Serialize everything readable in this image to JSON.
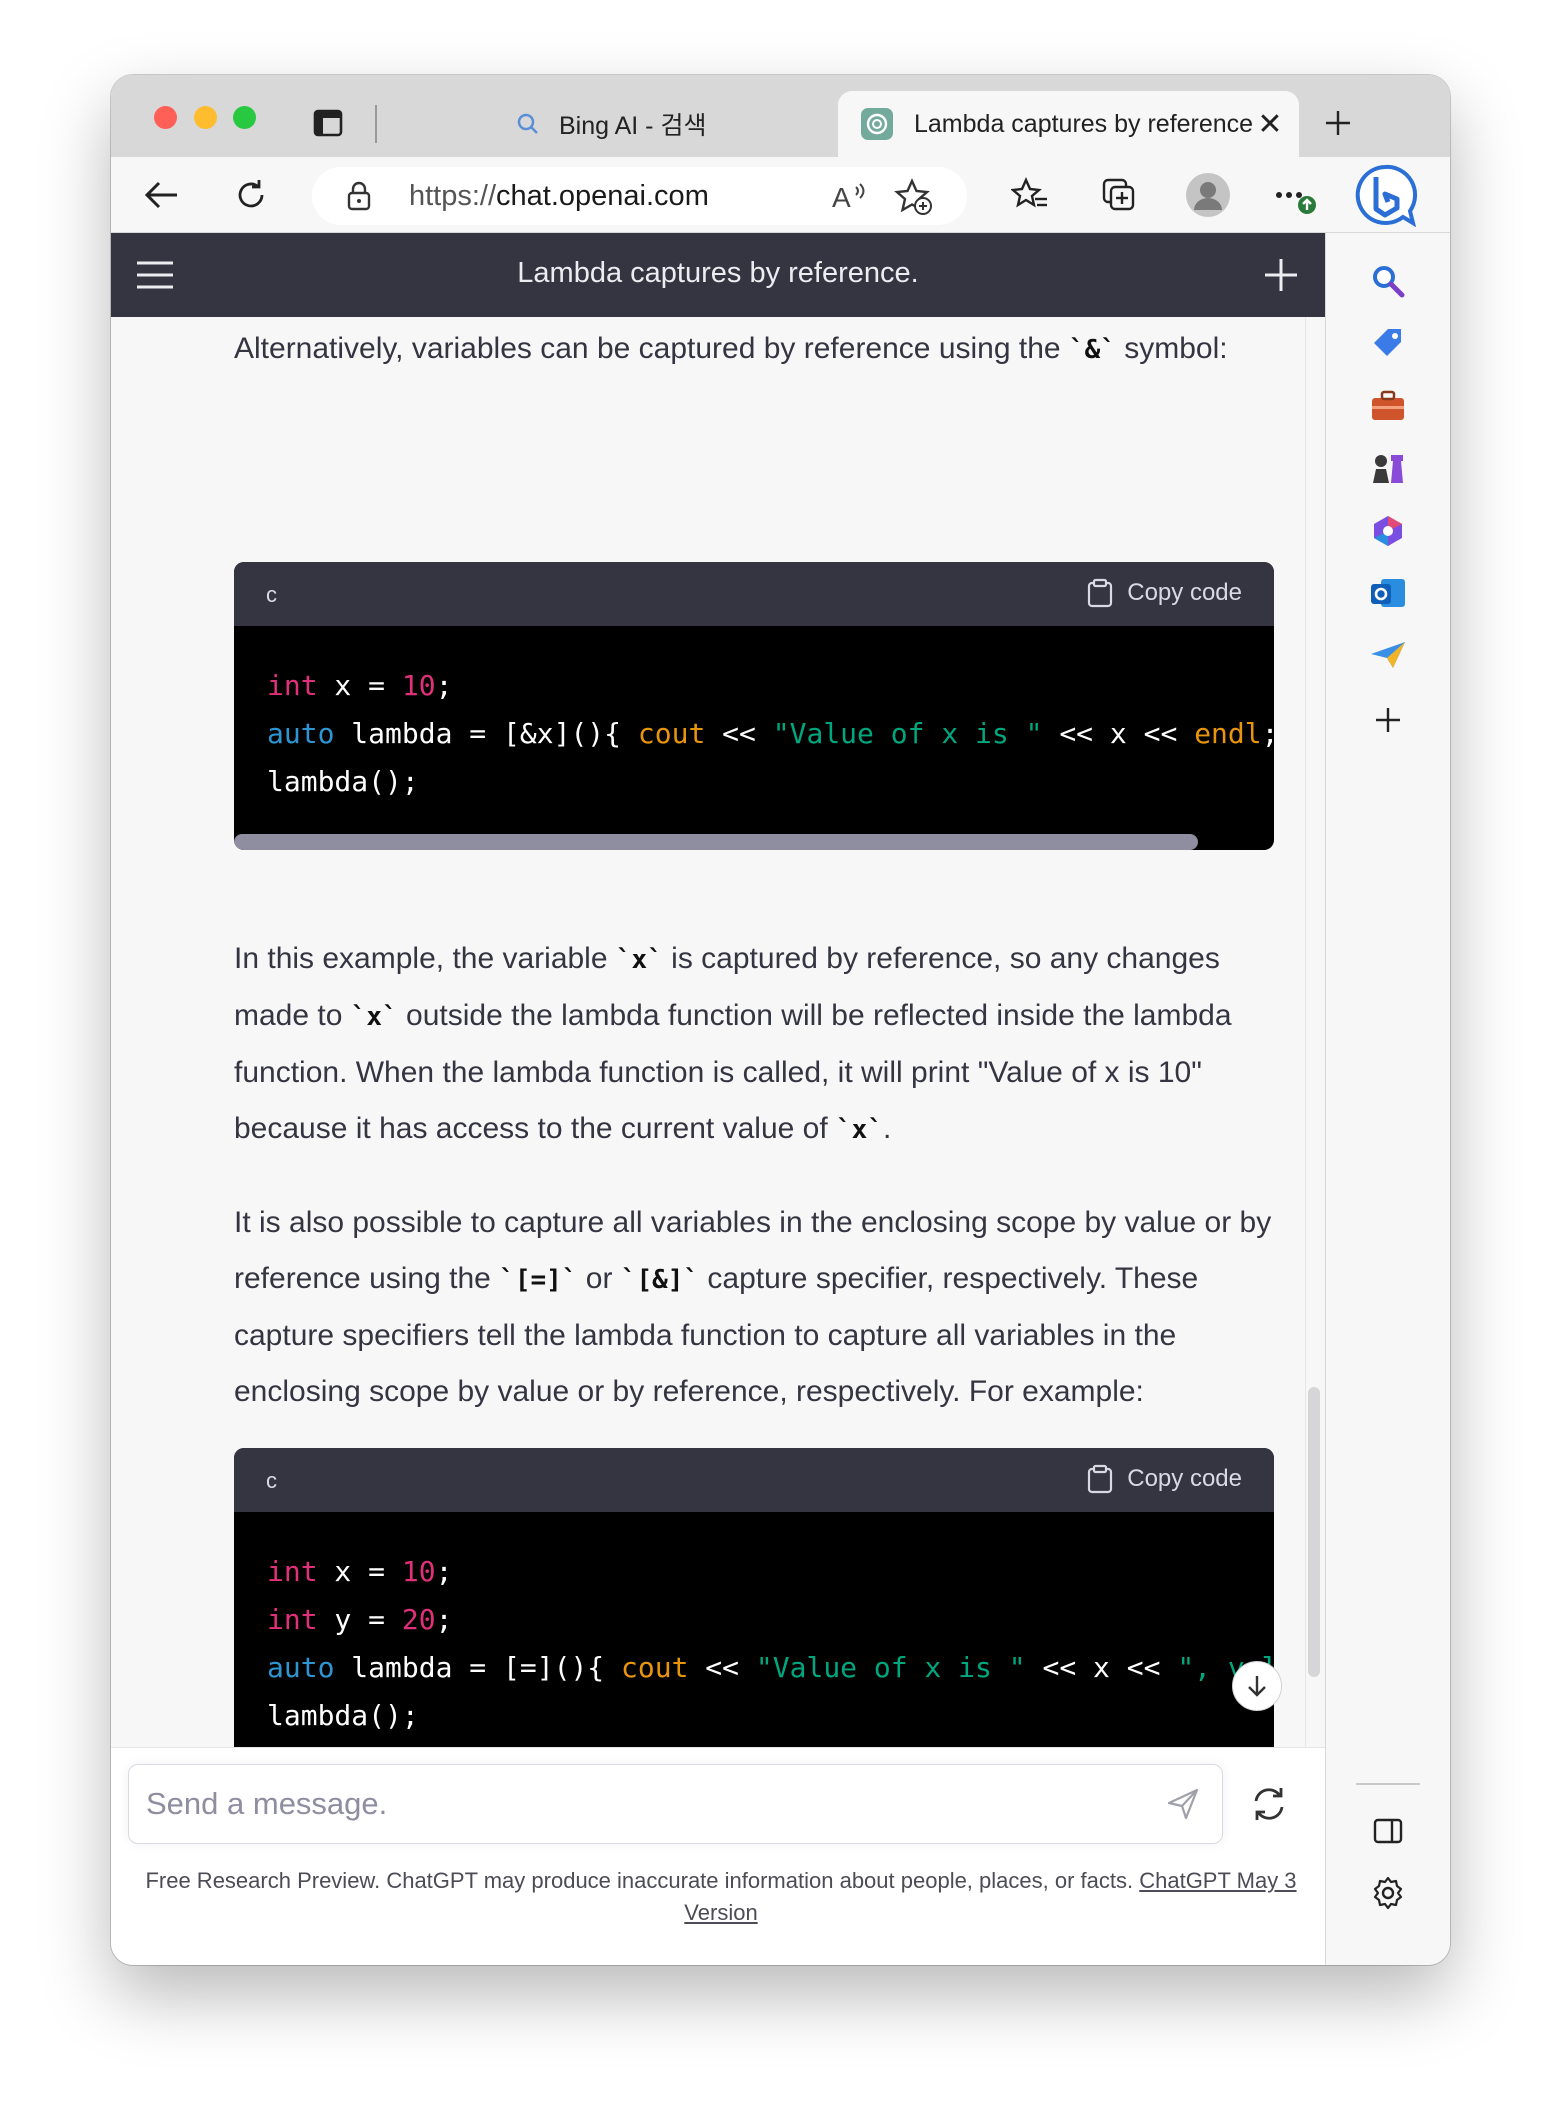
{
  "browser": {
    "tabs": [
      {
        "title": "Bing AI - 검색",
        "active": false
      },
      {
        "title": "Lambda captures by reference",
        "active": true
      }
    ],
    "address": {
      "scheme": "https://",
      "host": "chat.openai.com"
    }
  },
  "chat": {
    "header_title": "Lambda captures by reference.",
    "p1": {
      "pre": "Alternatively, variables can be captured by reference using the ",
      "code": "`&`",
      "post": " symbol:"
    },
    "code1": {
      "lang": "c",
      "copy_label": "Copy code",
      "lines": [
        [
          {
            "t": "int",
            "c": "k-red"
          },
          {
            "t": " x = "
          },
          {
            "t": "10",
            "c": "k-red"
          },
          {
            "t": ";"
          }
        ],
        [
          {
            "t": "auto",
            "c": "k-blue"
          },
          {
            "t": " lambda = [&x](){ "
          },
          {
            "t": "cout",
            "c": "k-yellow"
          },
          {
            "t": " << "
          },
          {
            "t": "\"Value of x is \"",
            "c": "k-green"
          },
          {
            "t": " << x << "
          },
          {
            "t": "endl",
            "c": "k-yellow"
          },
          {
            "t": "; };"
          }
        ],
        [
          {
            "t": "lambda();"
          }
        ]
      ]
    },
    "p2": {
      "s1": "In this example, the variable ",
      "c1": "`x`",
      "s2": " is captured by reference, so any changes made to ",
      "c2": "`x`",
      "s3": " outside the lambda function will be reflected inside the lambda function. When the lambda function is called, it will print \"Value of x is 10\" because it has access to the current value of ",
      "c3": "`x`",
      "s4": "."
    },
    "p3": {
      "s1": "It is also possible to capture all variables in the enclosing scope by value or by reference using the ",
      "c1": "`[=]`",
      "s2": " or ",
      "c2": "`[&]`",
      "s3": " capture specifier, respectively. These capture specifiers tell the lambda function to capture all variables in the enclosing scope by value or by reference, respectively. For example:"
    },
    "code2": {
      "lang": "c",
      "copy_label": "Copy code",
      "lines": [
        [
          {
            "t": "int",
            "c": "k-red"
          },
          {
            "t": " x = "
          },
          {
            "t": "10",
            "c": "k-red"
          },
          {
            "t": ";"
          }
        ],
        [
          {
            "t": "int",
            "c": "k-red"
          },
          {
            "t": " y = "
          },
          {
            "t": "20",
            "c": "k-red"
          },
          {
            "t": ";"
          }
        ],
        [
          {
            "t": "auto",
            "c": "k-blue"
          },
          {
            "t": " lambda = [=](){ "
          },
          {
            "t": "cout",
            "c": "k-yellow"
          },
          {
            "t": " << "
          },
          {
            "t": "\"Value of x is \"",
            "c": "k-green"
          },
          {
            "t": " << x << "
          },
          {
            "t": "\", val",
            "c": "k-green"
          }
        ],
        [
          {
            "t": "lambda();"
          }
        ]
      ]
    }
  },
  "composer": {
    "placeholder": "Send a message.",
    "disclaimer_text": "Free Research Preview. ChatGPT may produce inaccurate information about people, places, or facts. ",
    "disclaimer_link": "ChatGPT May 3 Version"
  },
  "colors": {
    "header_bg": "#343541",
    "code_bg": "#000000",
    "code_head_bg": "#343541"
  }
}
